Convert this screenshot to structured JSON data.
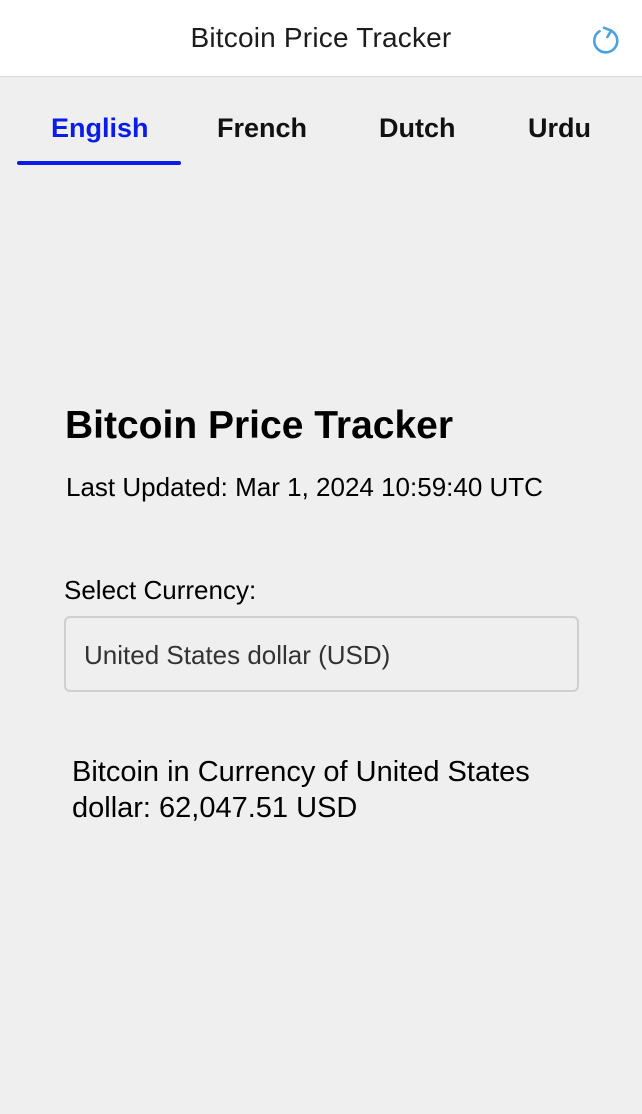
{
  "navbar": {
    "title": "Bitcoin Price Tracker",
    "refresh_icon": "refresh-icon",
    "refresh_color": "#4aa3e0"
  },
  "tabs": [
    {
      "label": "English",
      "active": true
    },
    {
      "label": "French",
      "active": false
    },
    {
      "label": "Dutch",
      "active": false
    },
    {
      "label": "Urdu",
      "active": false
    }
  ],
  "accent_color": "#0a1de6",
  "main": {
    "title": "Bitcoin Price Tracker",
    "last_updated": "Last Updated: Mar 1, 2024 10:59:40 UTC",
    "select_label": "Select Currency:",
    "selected_currency": "United States dollar (USD)",
    "result_text": "Bitcoin in Currency of United States dollar: 62,047.51 USD"
  }
}
